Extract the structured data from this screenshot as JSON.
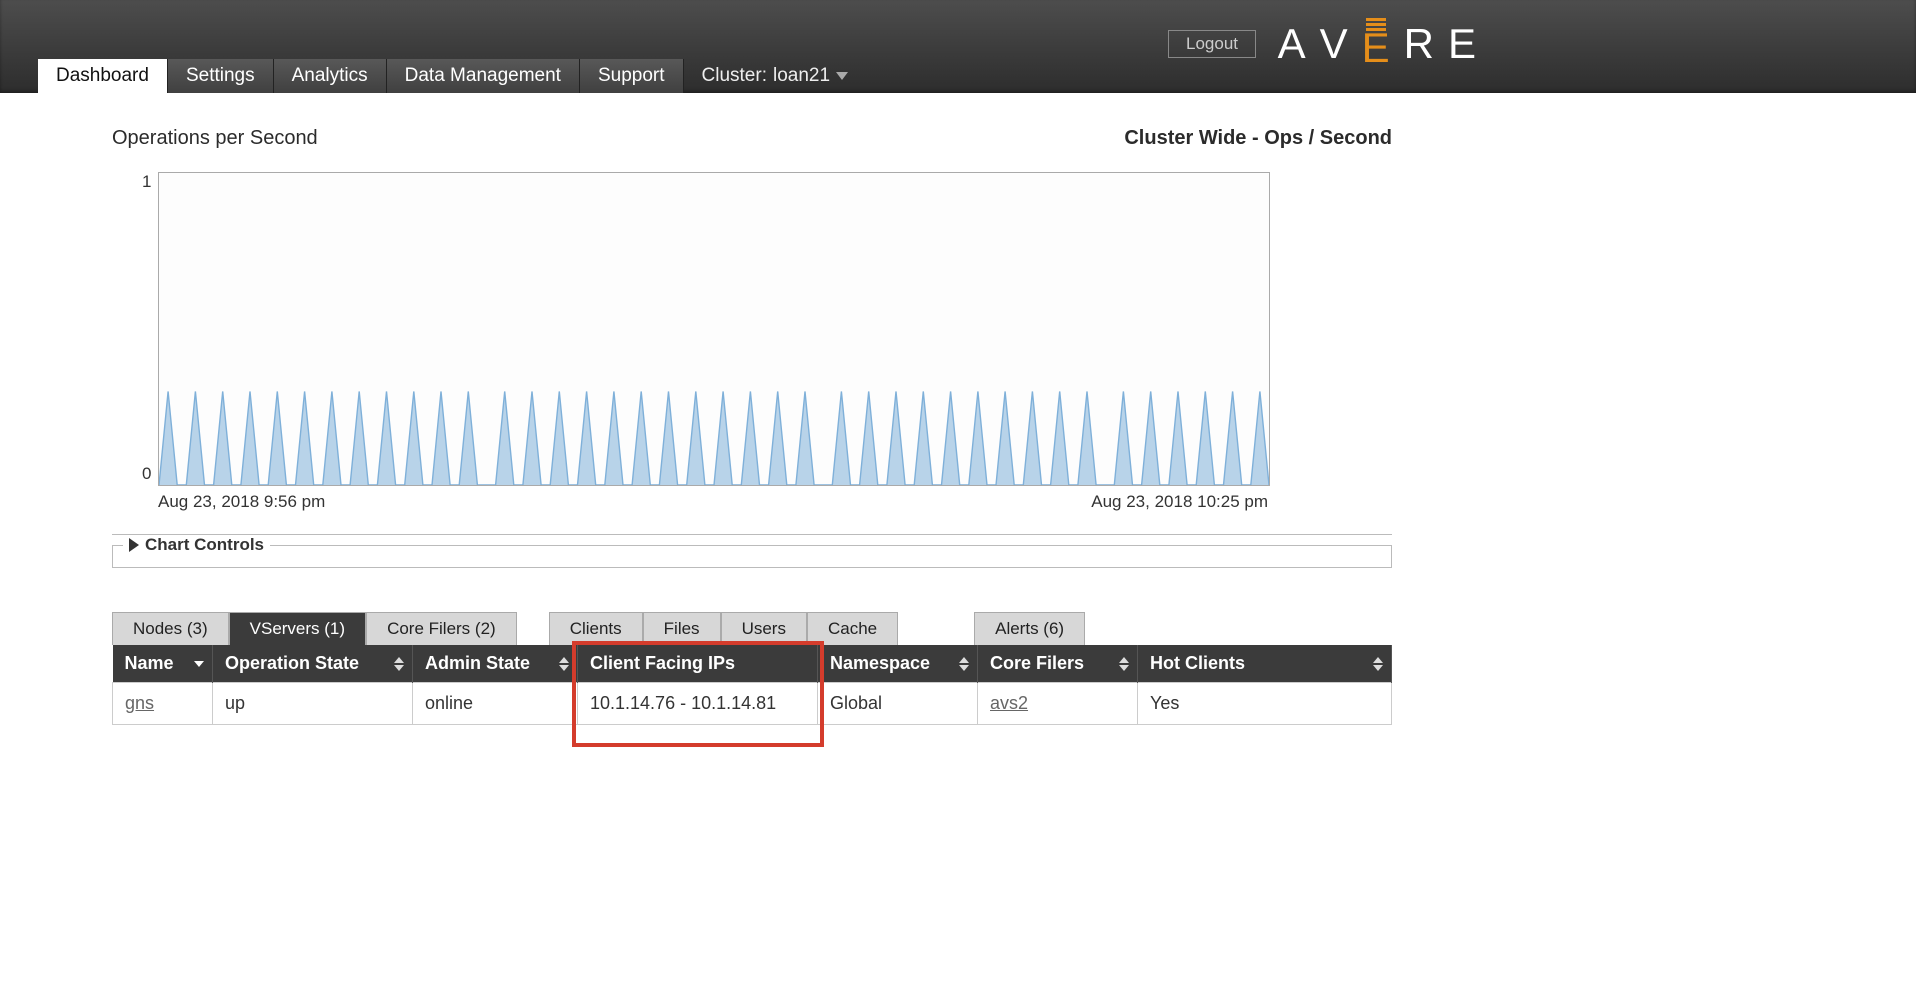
{
  "header": {
    "logout": "Logout",
    "logo_letters": [
      "A",
      "V",
      "E",
      "R",
      "E"
    ]
  },
  "nav": {
    "tabs": [
      "Dashboard",
      "Settings",
      "Analytics",
      "Data Management",
      "Support"
    ],
    "active_index": 0,
    "cluster_label_prefix": "Cluster:",
    "cluster_name": "loan21"
  },
  "chart_titles": {
    "left": "Operations per Second",
    "right": "Cluster Wide - Ops / Second"
  },
  "chart_data": {
    "type": "line",
    "title": "Operations per Second",
    "xlabel": "",
    "ylabel": "",
    "ylim": [
      0,
      1
    ],
    "x_start_label": "Aug 23, 2018 9:56 pm",
    "x_end_label": "Aug 23, 2018 10:25 pm",
    "y_ticks": [
      0,
      1
    ],
    "series": [
      {
        "name": "ops",
        "color": "#7fb0d9",
        "values": [
          0,
          0.3,
          0,
          0,
          0.3,
          0,
          0,
          0.3,
          0,
          0,
          0.3,
          0,
          0,
          0.3,
          0,
          0,
          0.3,
          0,
          0,
          0.3,
          0,
          0,
          0.3,
          0,
          0,
          0.3,
          0,
          0,
          0.3,
          0,
          0,
          0.3,
          0,
          0,
          0.3,
          0,
          0,
          0,
          0.3,
          0,
          0,
          0.3,
          0,
          0,
          0.3,
          0,
          0,
          0.3,
          0,
          0,
          0.3,
          0,
          0,
          0.3,
          0,
          0,
          0.3,
          0,
          0,
          0.3,
          0,
          0,
          0.3,
          0,
          0,
          0.3,
          0,
          0,
          0.3,
          0,
          0,
          0.3,
          0,
          0,
          0,
          0.3,
          0,
          0,
          0.3,
          0,
          0,
          0.3,
          0,
          0,
          0.3,
          0,
          0,
          0.3,
          0,
          0,
          0.3,
          0,
          0,
          0.3,
          0,
          0,
          0.3,
          0,
          0,
          0.3,
          0,
          0,
          0.3,
          0,
          0,
          0,
          0.3,
          0,
          0,
          0.3,
          0,
          0,
          0.3,
          0,
          0,
          0.3,
          0,
          0,
          0.3,
          0,
          0,
          0.3,
          0
        ]
      }
    ]
  },
  "chart_controls_label": "Chart Controls",
  "subtabs": {
    "group1": [
      "Nodes (3)",
      "VServers (1)",
      "Core Filers (2)"
    ],
    "group1_active": 1,
    "group2": [
      "Clients",
      "Files",
      "Users",
      "Cache"
    ],
    "group3": [
      "Alerts (6)"
    ]
  },
  "table": {
    "columns": [
      "Name",
      "Operation State",
      "Admin State",
      "Client Facing IPs",
      "Namespace",
      "Core Filers",
      "Hot Clients"
    ],
    "sort_column": 0,
    "rows": [
      {
        "name": "gns",
        "operation_state": "up",
        "admin_state": "online",
        "client_ips": "10.1.14.76 - 10.1.14.81",
        "namespace": "Global",
        "core_filers": "avs2",
        "hot_clients": "Yes"
      }
    ]
  },
  "highlight_column_index": 3
}
